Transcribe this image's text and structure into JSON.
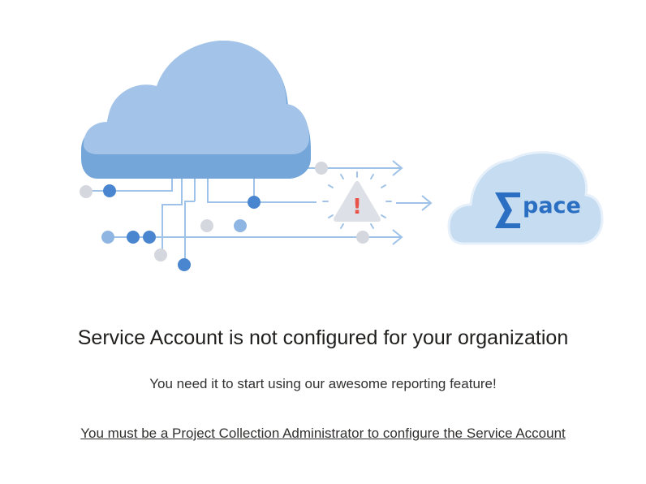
{
  "illustration": {
    "brand_name": "pace",
    "warning_symbol": "!",
    "icons": [
      "cloud-icon",
      "warning-triangle-icon",
      "pace-logo-icon",
      "sigma-logo-icon",
      "arrow-right-icon"
    ]
  },
  "message": {
    "title": "Service Account is not configured for your organization",
    "subtitle": "You need it to start using our awesome reporting feature!",
    "admin_link": "You must be a Project Collection Administrator to configure the Service Account"
  },
  "colors": {
    "cloud_light": "#a3c4e8",
    "cloud_dark": "#6f9fd6",
    "node_blue": "#4a86cf",
    "node_grey": "#d4d8de",
    "line_blue": "#9ec2e8",
    "brand_blue": "#2b6fc2",
    "warning_red": "#e8534a"
  }
}
